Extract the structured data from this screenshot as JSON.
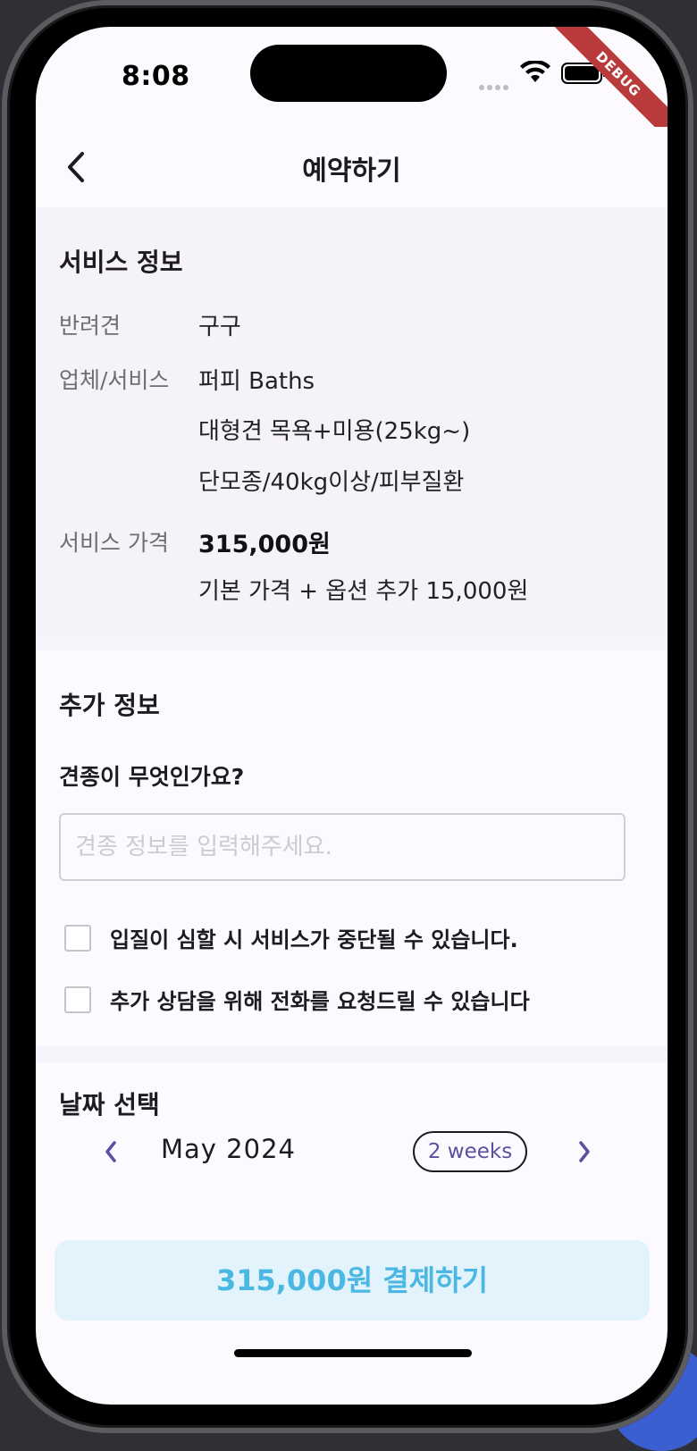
{
  "status": {
    "time": "8:08",
    "debug_label": "DEBUG"
  },
  "appbar": {
    "title": "예약하기"
  },
  "service_info": {
    "title": "서비스 정보",
    "pet_label": "반려견",
    "pet_value": "구구",
    "company_label": "업체/서비스",
    "company_value": "퍼피 Baths",
    "service_lines": [
      "대형견 목욕+미용(25kg~)",
      "단모종/40kg이상/피부질환"
    ],
    "price_label": "서비스 가격",
    "price_value": "315,000원",
    "price_note": "기본 가격 + 옵션 추가 15,000원"
  },
  "extra_info": {
    "title": "추가 정보",
    "question": "견종이 무엇인가요?",
    "breed_input": {
      "value": "",
      "placeholder": "견종 정보를 입력해주세요."
    },
    "checks": [
      {
        "label": "입질이 심할 시 서비스가 중단될 수 있습니다.",
        "checked": false
      },
      {
        "label": "추가 상담을 위해 전화를 요청드릴 수 있습니다",
        "checked": false
      }
    ]
  },
  "date_select": {
    "title": "날짜 선택",
    "month": "May 2024",
    "view_toggle": "2 weeks"
  },
  "pay_button": {
    "label": "315,000원 결제하기"
  },
  "colors": {
    "accent": "#5d4ea0",
    "pay_bg": "#e2f3fb",
    "pay_text": "#4ab8e2",
    "debug": "#b83a3a"
  },
  "icons": {
    "back": "chevron-left-icon",
    "prev": "chevron-left-icon",
    "next": "chevron-right-icon"
  }
}
